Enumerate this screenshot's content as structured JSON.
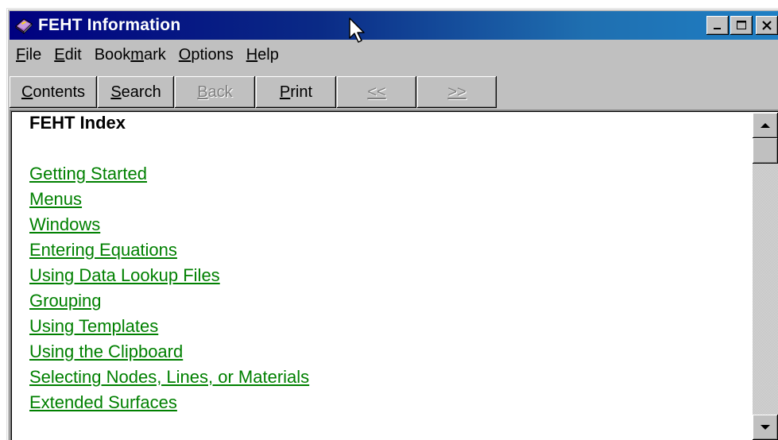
{
  "window": {
    "title": "FEHT Information",
    "icon": "help-book-icon",
    "caption_buttons": [
      "minimize-icon",
      "maximize-icon",
      "close-icon"
    ]
  },
  "menu": [
    {
      "mnemonic": "F",
      "rest": "ile"
    },
    {
      "mnemonic": "E",
      "rest": "dit"
    },
    {
      "before": "Book",
      "mnemonic": "m",
      "rest": "ark"
    },
    {
      "mnemonic": "O",
      "rest": "ptions"
    },
    {
      "mnemonic": "H",
      "rest": "elp"
    }
  ],
  "toolbar": {
    "contents": {
      "mnemonic": "C",
      "rest": "ontents"
    },
    "search": {
      "mnemonic": "S",
      "rest": "earch"
    },
    "back": {
      "mnemonic": "B",
      "rest": "ack"
    },
    "print": {
      "mnemonic": "P",
      "rest": "rint"
    },
    "prev": "<<",
    "next": ">>"
  },
  "content": {
    "heading": "FEHT Index",
    "link_color": "#008000",
    "links": [
      "Getting Started",
      "Menus",
      "Windows",
      "Entering Equations",
      "Using Data Lookup Files",
      "Grouping",
      "Using Templates",
      "Using the Clipboard",
      "Selecting Nodes, Lines, or Materials",
      "Extended Surfaces"
    ]
  },
  "scrollbar": {
    "up": "scroll-up-arrow-icon",
    "down": "scroll-down-arrow-icon"
  },
  "colors": {
    "titlebar_start": "#000080",
    "titlebar_end": "#1f7fc4",
    "face": "#c0c0c0"
  }
}
